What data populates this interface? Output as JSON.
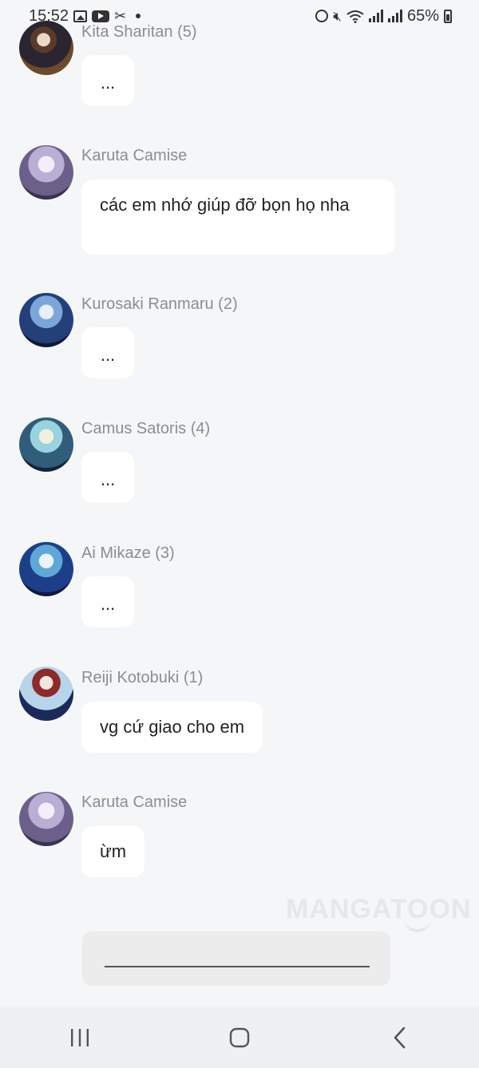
{
  "status_bar": {
    "time": "15:52",
    "battery": "65%",
    "left_icons": [
      "gallery-icon",
      "youtube-icon",
      "capcut-icon",
      "notification-dot-icon"
    ],
    "right_icons": [
      "alarm-icon",
      "mute-icon",
      "wifi-icon",
      "signal-icon",
      "signal-icon",
      "battery-icon"
    ]
  },
  "messages": [
    {
      "sender": "Kita Sharitan (5)",
      "text": "...",
      "avatar": "avatar-guitarist"
    },
    {
      "sender": "Karuta Camise",
      "text": "các em nhớ giúp đỡ bọn họ nha",
      "avatar": "avatar-silver-hair"
    },
    {
      "sender": "Kurosaki Ranmaru (2)",
      "text": "...",
      "avatar": "avatar-stage-blue"
    },
    {
      "sender": "Camus Satoris (4)",
      "text": "...",
      "avatar": "avatar-stage-teal"
    },
    {
      "sender": "Ai Mikaze (3)",
      "text": "...",
      "avatar": "avatar-stage-cyan"
    },
    {
      "sender": "Reiji Kotobuki (1)",
      "text": "vg cứ giao cho em",
      "avatar": "avatar-red-hair"
    },
    {
      "sender": "Karuta Camise",
      "text": "ừm",
      "avatar": "avatar-silver-hair"
    }
  ],
  "watermark": "MANGATOON",
  "input": {
    "value": "",
    "placeholder": ""
  },
  "colors": {
    "background": "#f5f6f8",
    "bubble": "#ffffff",
    "sender": "#8a8d93",
    "input": "#ececec"
  }
}
